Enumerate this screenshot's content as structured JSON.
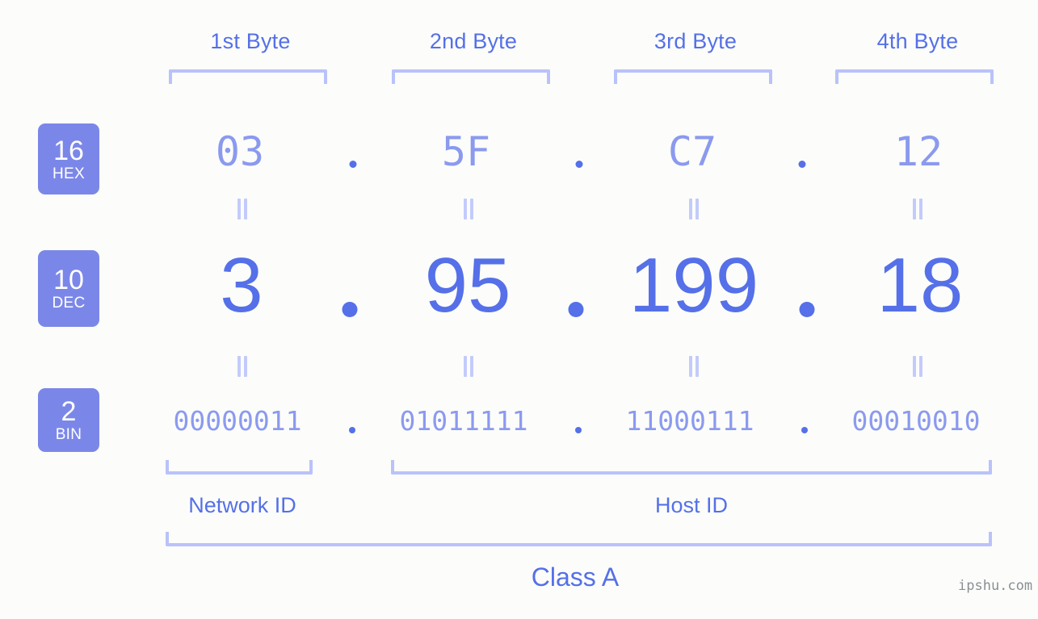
{
  "background_color": "#fcfdfa",
  "accent_colors": {
    "badge_bg": "#7b87e8",
    "badge_text": "#ffffff",
    "strong_blue": "#5570e8",
    "light_blue": "#8b9aef",
    "bracket": "#b9c2fb",
    "equals": "#c3cbfc",
    "watermark": "#8a8f96"
  },
  "byte_headers": [
    {
      "label": "1st Byte"
    },
    {
      "label": "2nd Byte"
    },
    {
      "label": "3rd Byte"
    },
    {
      "label": "4th Byte"
    }
  ],
  "rows": [
    {
      "badge_number": "16",
      "badge_name": "HEX",
      "values": [
        "03",
        "5F",
        "C7",
        "12"
      ],
      "separator": "."
    },
    {
      "badge_number": "10",
      "badge_name": "DEC",
      "values": [
        "3",
        "95",
        "199",
        "18"
      ],
      "separator": "."
    },
    {
      "badge_number": "2",
      "badge_name": "BIN",
      "values": [
        "00000011",
        "01011111",
        "11000111",
        "00010010"
      ],
      "separator": "."
    }
  ],
  "equals_glyph": "||",
  "regions": [
    {
      "label": "Network ID"
    },
    {
      "label": "Host ID"
    }
  ],
  "class_label": "Class A",
  "watermark": "ipshu.com"
}
